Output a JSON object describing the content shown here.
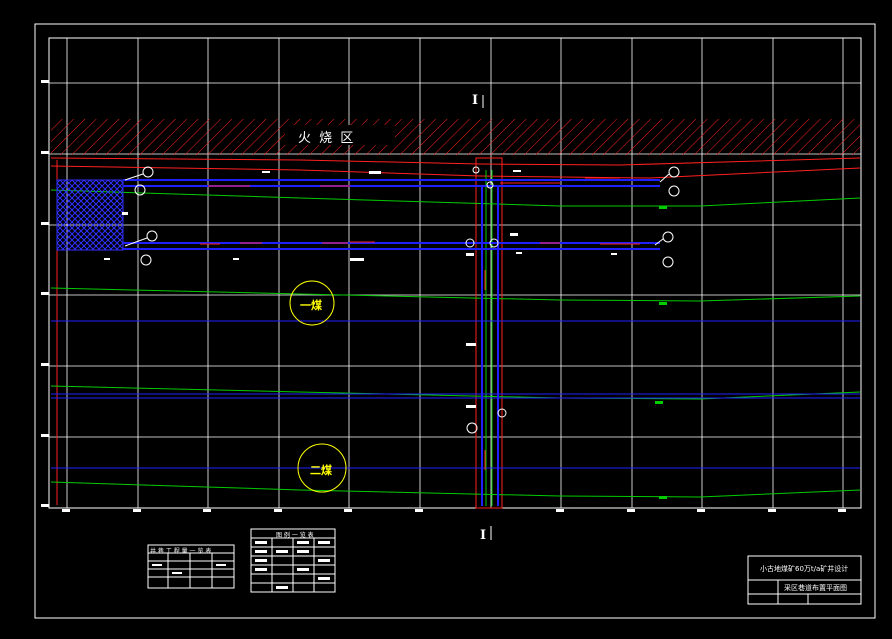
{
  "drawing": {
    "fire_zone_label": "火 烧 区",
    "section_marks": [
      "I",
      "I"
    ],
    "coal_seams": [
      "一煤",
      "二煤"
    ],
    "title_block": {
      "project": "小古地煤矿60万t/a矿井设计",
      "drawing_name": "采区巷道布置平面图"
    },
    "legend_table_left": {
      "title": "井 巷 工 程 量 一 览 表"
    },
    "legend_table_right": {
      "title": "图 例 一 览 表"
    }
  },
  "colors": {
    "background": "#000000",
    "grid": "#ffffff",
    "roadway": "#2020ff",
    "seam_contour": "#00cc00",
    "boundary": "#ff2020",
    "coal_label": "#ffff00"
  }
}
